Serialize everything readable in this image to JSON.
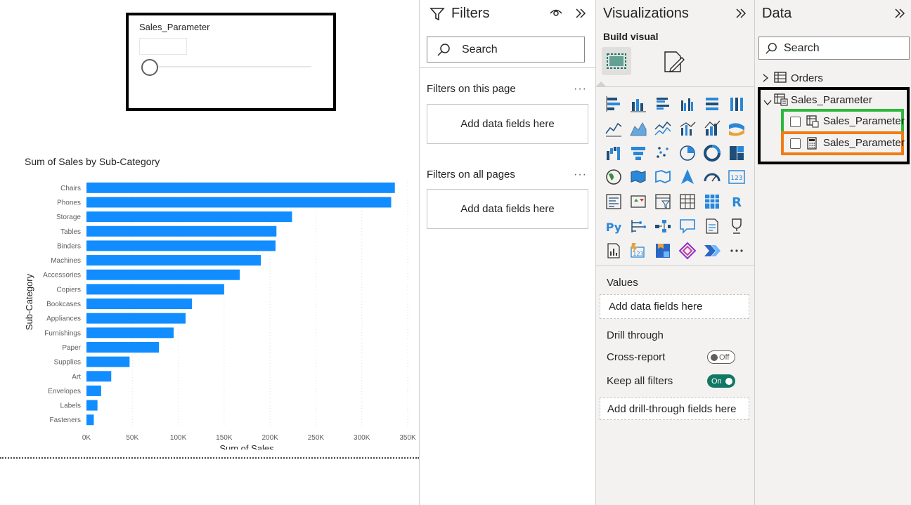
{
  "slicer": {
    "title": "Sales_Parameter"
  },
  "chart_data": {
    "type": "bar",
    "orientation": "horizontal",
    "title": "Sum of Sales by Sub-Category",
    "xlabel": "Sum of Sales",
    "ylabel": "Sub-Category",
    "categories": [
      "Chairs",
      "Phones",
      "Storage",
      "Tables",
      "Binders",
      "Machines",
      "Accessories",
      "Copiers",
      "Bookcases",
      "Appliances",
      "Furnishings",
      "Paper",
      "Supplies",
      "Art",
      "Envelopes",
      "Labels",
      "Fasteners"
    ],
    "values": [
      336000,
      332000,
      224000,
      207000,
      206000,
      190000,
      167000,
      150000,
      115000,
      108000,
      95000,
      79000,
      47000,
      27000,
      16000,
      12000,
      8000
    ],
    "xlim": [
      0,
      350000
    ],
    "xticks": [
      "0K",
      "50K",
      "100K",
      "150K",
      "200K",
      "250K",
      "300K",
      "350K"
    ],
    "bar_color": "#118DFF",
    "grid": true
  },
  "filters": {
    "title": "Filters",
    "search_placeholder": "Search",
    "page_section": "Filters on this page",
    "all_section": "Filters on all pages",
    "add_fields": "Add data fields here",
    "more": "···"
  },
  "visualizations": {
    "title": "Visualizations",
    "build_visual": "Build visual",
    "values_label": "Values",
    "values_well": "Add data fields here",
    "drill_through": "Drill through",
    "cross_report": "Cross-report",
    "cross_report_state": "Off",
    "keep_all_filters": "Keep all filters",
    "keep_all_filters_state": "On",
    "drill_well": "Add drill-through fields here",
    "more": "···",
    "accent": "#117865"
  },
  "data_pane": {
    "title": "Data",
    "search_placeholder": "Search",
    "tables": [
      "Orders",
      "Sales_Parameter"
    ],
    "fields": [
      "Sales_Parameter",
      "Sales_Parameter"
    ],
    "highlight_colors": {
      "group": "#000000",
      "field_table": "#2db83d",
      "field_measure": "#f07d14"
    }
  }
}
